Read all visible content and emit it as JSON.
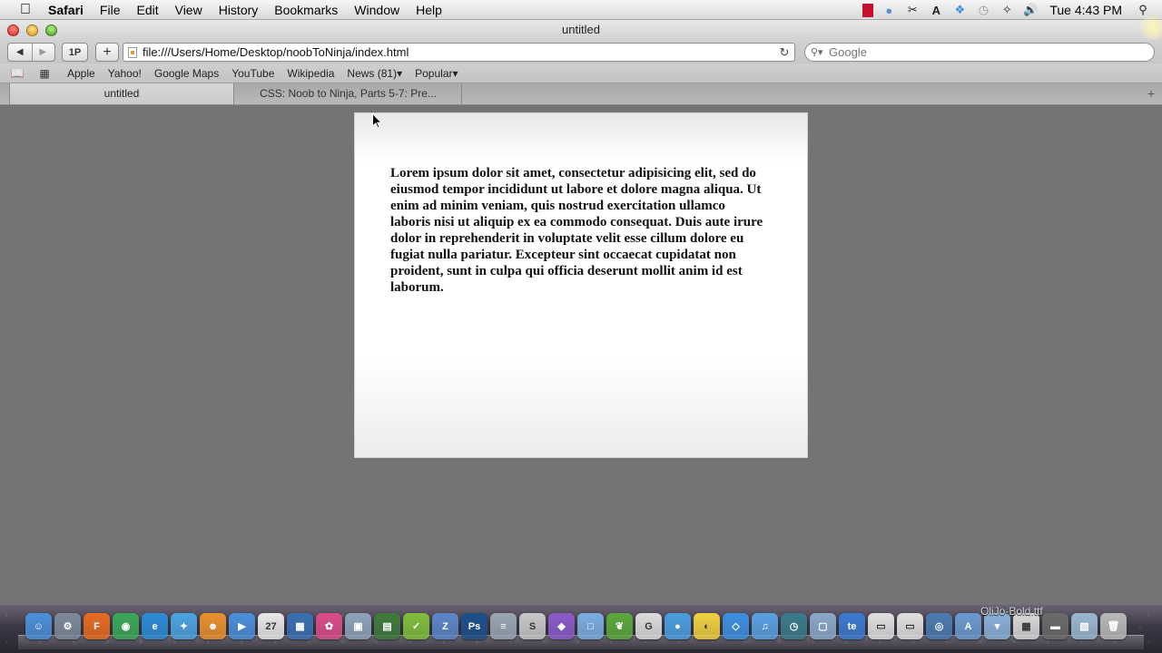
{
  "menubar": {
    "apple_icon": "apple-icon",
    "app_name": "Safari",
    "items": [
      "File",
      "Edit",
      "View",
      "History",
      "Bookmarks",
      "Window",
      "Help"
    ],
    "status_icons": [
      "flash-icon",
      "skype-icon",
      "scissors-icon",
      "adobe-icon",
      "dropbox-icon",
      "time-machine-icon",
      "bluetooth-icon",
      "volume-icon"
    ],
    "clock": "Tue 4:43 PM",
    "spotlight_icon": "spotlight-icon"
  },
  "window": {
    "title": "untitled"
  },
  "toolbar": {
    "back_label": "◀",
    "forward_label": "▶",
    "onepassword_label": "1P",
    "add_label": "+",
    "url": "file:///Users/Home/Desktop/noobToNinja/index.html",
    "reload_label": "↻",
    "search_placeholder": "Google"
  },
  "bookmarks": {
    "reading_icon": "book-icon",
    "topsites_icon": "grid-icon",
    "items": [
      "Apple",
      "Yahoo!",
      "Google Maps",
      "YouTube",
      "Wikipedia",
      "News (81)▾",
      "Popular▾"
    ]
  },
  "tabs": [
    {
      "label": "untitled",
      "active": true
    },
    {
      "label": "CSS: Noob to Ninja, Parts 5-7: Pre...",
      "active": false
    }
  ],
  "tab_add_label": "+",
  "page": {
    "paragraph": "Lorem ipsum dolor sit amet, consectetur adipisicing elit, sed do eiusmod tempor incididunt ut labore et dolore magna aliqua. Ut enim ad minim veniam, quis nostrud exercitation ullamco laboris nisi ut aliquip ex ea commodo consequat. Duis aute irure dolor in reprehenderit in voluptate velit esse cillum dolore eu fugiat nulla pariatur. Excepteur sint occaecat cupidatat non proident, sunt in culpa qui officia deserunt mollit anim id est laborum."
  },
  "dock": {
    "hover_label": "OliJo-Bold.ttf",
    "apps": [
      {
        "name": "finder",
        "color": "#4a8fd8",
        "glyph": "☺"
      },
      {
        "name": "system-preferences",
        "color": "#7d8a99",
        "glyph": "⚙"
      },
      {
        "name": "firefox",
        "color": "#e66b1f",
        "glyph": "F"
      },
      {
        "name": "chrome",
        "color": "#3aa757",
        "glyph": "◉"
      },
      {
        "name": "internet-explorer",
        "color": "#2b8bd6",
        "glyph": "e"
      },
      {
        "name": "safari",
        "color": "#4aa3e0",
        "glyph": "✦"
      },
      {
        "name": "adium",
        "color": "#e8902c",
        "glyph": "☻"
      },
      {
        "name": "facetime",
        "color": "#4a8fd8",
        "glyph": "▶"
      },
      {
        "name": "ical",
        "color": "#e8e8e8",
        "glyph": "27"
      },
      {
        "name": "dashboard",
        "color": "#3a6fb0",
        "glyph": "▦"
      },
      {
        "name": "picasa",
        "color": "#d94c8a",
        "glyph": "✿"
      },
      {
        "name": "preview",
        "color": "#8fa3b8",
        "glyph": "▣"
      },
      {
        "name": "imovie",
        "color": "#3e7a3a",
        "glyph": "▤"
      },
      {
        "name": "things",
        "color": "#7fbf3a",
        "glyph": "✓"
      },
      {
        "name": "textmate",
        "color": "#5a86c8",
        "glyph": "Z"
      },
      {
        "name": "photoshop",
        "color": "#1c4f8a",
        "glyph": "Ps"
      },
      {
        "name": "database",
        "color": "#9aa6b2",
        "glyph": "≡"
      },
      {
        "name": "script-editor",
        "color": "#c8c8c8",
        "glyph": "S"
      },
      {
        "name": "coda",
        "color": "#8a5ac8",
        "glyph": "◆"
      },
      {
        "name": "virtualbox",
        "color": "#7aaee0",
        "glyph": "□"
      },
      {
        "name": "evernote-leaf",
        "color": "#5aa83a",
        "glyph": "❦"
      },
      {
        "name": "gmail",
        "color": "#dcdcdc",
        "glyph": "G"
      },
      {
        "name": "messages",
        "color": "#4a9ee0",
        "glyph": "●"
      },
      {
        "name": "growl",
        "color": "#f0d040",
        "glyph": "◐"
      },
      {
        "name": "dropbox",
        "color": "#3a8fe0",
        "glyph": "◇"
      },
      {
        "name": "itunes",
        "color": "#5aa0e0",
        "glyph": "♫"
      },
      {
        "name": "time-machine",
        "color": "#3a7a8a",
        "glyph": "◷"
      },
      {
        "name": "cube",
        "color": "#8aa8c8",
        "glyph": "▢"
      },
      {
        "name": "te-app",
        "color": "#3a7ad0",
        "glyph": "te"
      },
      {
        "name": "document-1",
        "color": "#e0e0e0",
        "glyph": "▭"
      },
      {
        "name": "document-2",
        "color": "#e0e0e0",
        "glyph": "▭"
      },
      {
        "name": "network-utility",
        "color": "#4a7ab0",
        "glyph": "◎"
      },
      {
        "name": "applications-folder",
        "color": "#6a9ad0",
        "glyph": "A"
      },
      {
        "name": "downloads-stack",
        "color": "#8ab0d8",
        "glyph": "▾"
      },
      {
        "name": "documents-stack",
        "color": "#d8d8d8",
        "glyph": "▦"
      },
      {
        "name": "screenshot-stack",
        "color": "#6a6a6a",
        "glyph": "▬"
      },
      {
        "name": "images-stack",
        "color": "#9ab8d0",
        "glyph": "▧"
      },
      {
        "name": "trash",
        "color": "#b8b8b8",
        "glyph": "🗑"
      }
    ]
  }
}
